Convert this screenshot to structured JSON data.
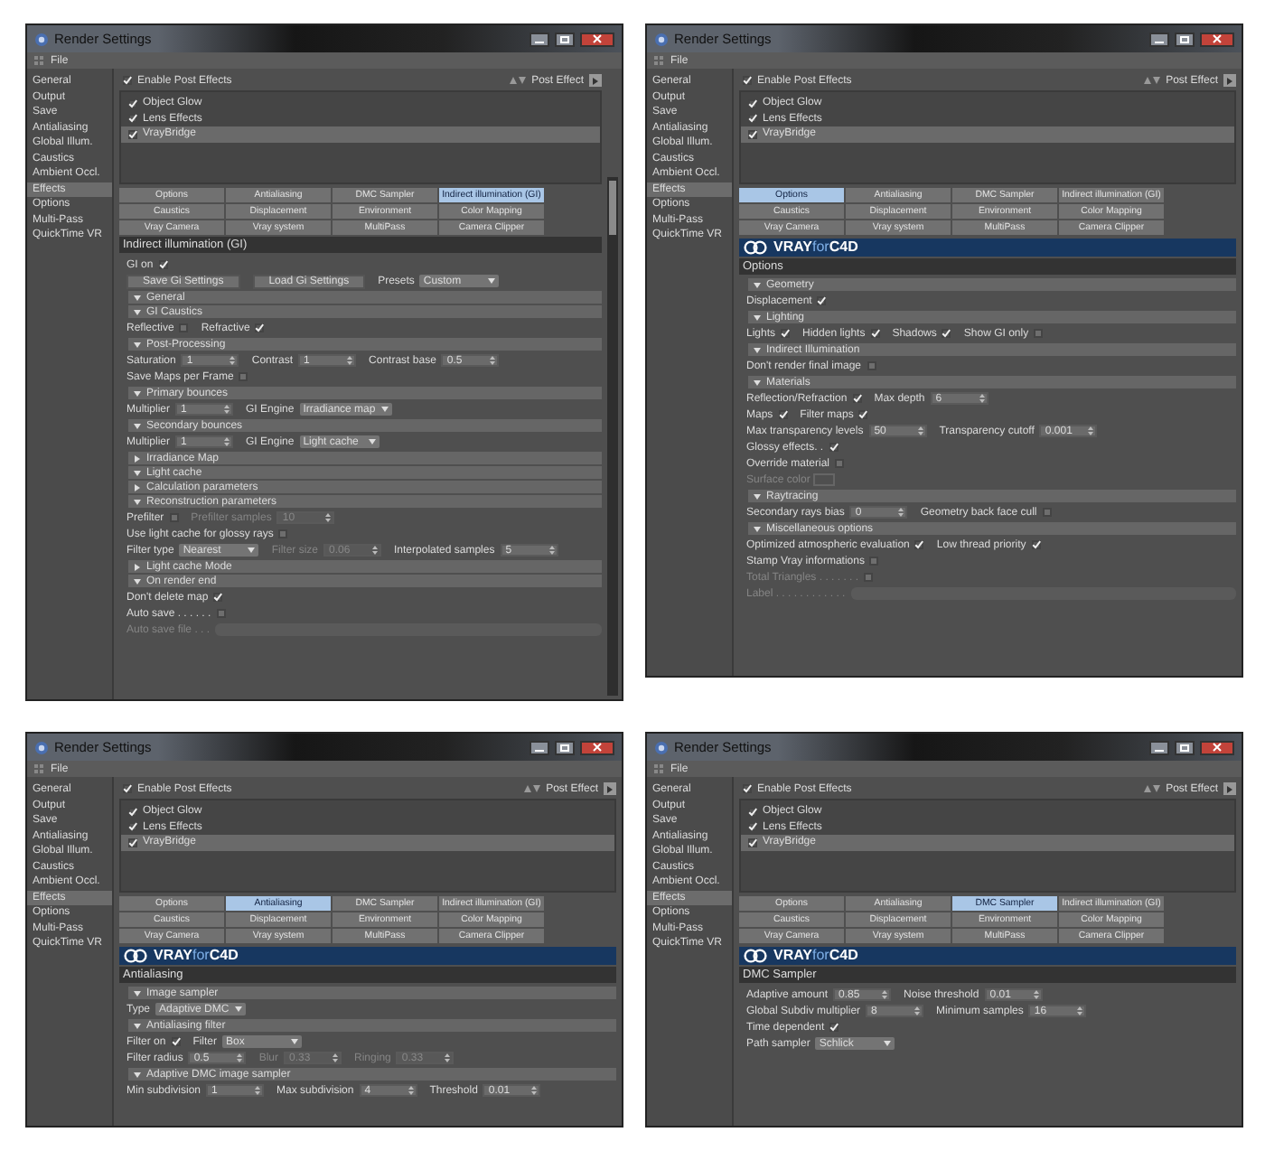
{
  "windows": [
    {
      "title": "Render Settings",
      "menu": [
        "File"
      ],
      "sidebar": [
        {
          "label": "General",
          "selected": false
        },
        {
          "label": "Output",
          "selected": false
        },
        {
          "label": "Save",
          "selected": false
        },
        {
          "label": "Antialiasing",
          "selected": false
        },
        {
          "label": "Global Illum.",
          "selected": false
        },
        {
          "label": "Caustics",
          "selected": false
        },
        {
          "label": "Ambient Occl.",
          "selected": false
        },
        {
          "label": "Effects",
          "selected": true
        },
        {
          "label": "Options",
          "selected": false
        },
        {
          "label": "Multi-Pass",
          "selected": false
        },
        {
          "label": "QuickTime VR",
          "selected": false
        }
      ],
      "enable_post_effects": {
        "label": "Enable Post Effects",
        "checked": true
      },
      "post_effect_label": "Post Effect",
      "effects": [
        {
          "label": "Object Glow",
          "checked": true,
          "selected": false
        },
        {
          "label": "Lens Effects",
          "checked": true,
          "selected": false
        },
        {
          "label": "VrayBridge",
          "checked": true,
          "selected": true
        }
      ],
      "tabs": [
        {
          "label": "Options",
          "selected": false
        },
        {
          "label": "Antialiasing",
          "selected": false
        },
        {
          "label": "DMC Sampler",
          "selected": false
        },
        {
          "label": "Indirect illumination (GI)",
          "selected": true
        },
        {
          "label": "Caustics",
          "selected": false
        },
        {
          "label": "Displacement",
          "selected": false
        },
        {
          "label": "Environment",
          "selected": false
        },
        {
          "label": "Color Mapping",
          "selected": false
        },
        {
          "label": "Vray Camera",
          "selected": false
        },
        {
          "label": "Vray system",
          "selected": false
        },
        {
          "label": "MultiPass",
          "selected": false
        },
        {
          "label": "Camera Clipper",
          "selected": false
        }
      ],
      "panel_title": "Indirect illumination (GI)",
      "scrollbar": true,
      "rows": [
        {
          "kind": "fields",
          "items": [
            {
              "kind": "checkbox",
              "label": "GI on",
              "checked": true,
              "disabled": false
            }
          ]
        },
        {
          "kind": "fields",
          "items": [
            {
              "kind": "button",
              "label": "Save Gi Settings"
            },
            {
              "kind": "button",
              "label": "Load Gi Settings"
            },
            {
              "kind": "dropdown",
              "label": "Presets",
              "value": "Custom",
              "disabled": false
            }
          ]
        },
        {
          "kind": "section",
          "label": "General",
          "expanded": true
        },
        {
          "kind": "section",
          "label": "GI Caustics",
          "expanded": true
        },
        {
          "kind": "fields",
          "items": [
            {
              "kind": "checkbox",
              "label": "Reflective",
              "checked": false,
              "disabled": false
            },
            {
              "kind": "checkbox",
              "label": "Refractive",
              "checked": true,
              "disabled": false
            }
          ]
        },
        {
          "kind": "section",
          "label": "Post-Processing",
          "expanded": true
        },
        {
          "kind": "fields",
          "items": [
            {
              "kind": "number",
              "label": "Saturation",
              "value": "1",
              "disabled": false
            },
            {
              "kind": "number",
              "label": "Contrast",
              "value": "1",
              "disabled": false
            },
            {
              "kind": "number",
              "label": "Contrast base",
              "value": "0.5",
              "disabled": false
            }
          ]
        },
        {
          "kind": "fields",
          "items": [
            {
              "kind": "checkbox",
              "label": "Save Maps per Frame",
              "checked": false,
              "disabled": false
            }
          ]
        },
        {
          "kind": "section",
          "label": "Primary bounces",
          "expanded": true
        },
        {
          "kind": "fields",
          "items": [
            {
              "kind": "number",
              "label": "Multiplier",
              "value": "1",
              "disabled": false
            },
            {
              "kind": "dropdown",
              "label": "GI Engine",
              "value": "Irradiance map",
              "disabled": false
            }
          ]
        },
        {
          "kind": "section",
          "label": "Secondary bounces",
          "expanded": true
        },
        {
          "kind": "fields",
          "items": [
            {
              "kind": "number",
              "label": "Multiplier",
              "value": "1",
              "disabled": false
            },
            {
              "kind": "dropdown",
              "label": "GI Engine",
              "value": "Light cache",
              "disabled": false
            }
          ]
        },
        {
          "kind": "section",
          "label": "Irradiance Map",
          "expanded": false
        },
        {
          "kind": "section",
          "label": "Light cache",
          "expanded": true
        },
        {
          "kind": "section",
          "label": "Calculation parameters",
          "expanded": false
        },
        {
          "kind": "section",
          "label": "Reconstruction parameters",
          "expanded": true
        },
        {
          "kind": "fields",
          "items": [
            {
              "kind": "checkbox",
              "label": "Prefilter",
              "checked": false,
              "disabled": false
            },
            {
              "kind": "number",
              "label": "Prefilter samples",
              "value": "10",
              "disabled": true
            }
          ]
        },
        {
          "kind": "fields",
          "items": [
            {
              "kind": "checkbox",
              "label": "Use light cache for glossy rays",
              "checked": false,
              "disabled": false
            }
          ]
        },
        {
          "kind": "fields",
          "items": [
            {
              "kind": "dropdown",
              "label": "Filter type",
              "value": "Nearest",
              "disabled": false
            },
            {
              "kind": "number",
              "label": "Filter size",
              "value": "0.06",
              "disabled": true
            },
            {
              "kind": "number",
              "label": "Interpolated samples",
              "value": "5",
              "disabled": false
            }
          ]
        },
        {
          "kind": "section",
          "label": "Light cache Mode",
          "expanded": false
        },
        {
          "kind": "section",
          "label": "On render end",
          "expanded": true
        },
        {
          "kind": "fields",
          "items": [
            {
              "kind": "checkbox",
              "label": "Don't delete map",
              "checked": true,
              "disabled": false
            }
          ]
        },
        {
          "kind": "fields",
          "items": [
            {
              "kind": "checkbox",
              "label": "Auto save . . . . . .",
              "checked": false,
              "disabled": false
            }
          ]
        },
        {
          "kind": "fields",
          "items": [
            {
              "kind": "text",
              "label": "Auto save file . . .",
              "disabled": true
            }
          ]
        }
      ]
    },
    {
      "title": "Render Settings",
      "menu": [
        "File"
      ],
      "sidebar": [
        {
          "label": "General",
          "selected": false
        },
        {
          "label": "Output",
          "selected": false
        },
        {
          "label": "Save",
          "selected": false
        },
        {
          "label": "Antialiasing",
          "selected": false
        },
        {
          "label": "Global Illum.",
          "selected": false
        },
        {
          "label": "Caustics",
          "selected": false
        },
        {
          "label": "Ambient Occl.",
          "selected": false
        },
        {
          "label": "Effects",
          "selected": true
        },
        {
          "label": "Options",
          "selected": false
        },
        {
          "label": "Multi-Pass",
          "selected": false
        },
        {
          "label": "QuickTime VR",
          "selected": false
        }
      ],
      "enable_post_effects": {
        "label": "Enable Post Effects",
        "checked": true
      },
      "post_effect_label": "Post Effect",
      "effects": [
        {
          "label": "Object Glow",
          "checked": true,
          "selected": false
        },
        {
          "label": "Lens Effects",
          "checked": true,
          "selected": false
        },
        {
          "label": "VrayBridge",
          "checked": true,
          "selected": true
        }
      ],
      "tabs": [
        {
          "label": "Options",
          "selected": true
        },
        {
          "label": "Antialiasing",
          "selected": false
        },
        {
          "label": "DMC Sampler",
          "selected": false
        },
        {
          "label": "Indirect illumination (GI)",
          "selected": false
        },
        {
          "label": "Caustics",
          "selected": false
        },
        {
          "label": "Displacement",
          "selected": false
        },
        {
          "label": "Environment",
          "selected": false
        },
        {
          "label": "Color Mapping",
          "selected": false
        },
        {
          "label": "Vray Camera",
          "selected": false
        },
        {
          "label": "Vray system",
          "selected": false
        },
        {
          "label": "MultiPass",
          "selected": false
        },
        {
          "label": "Camera Clipper",
          "selected": false
        }
      ],
      "logo": {
        "part_1": "VRAY",
        "part_2": "for",
        "part_3": "C4D"
      },
      "panel_title": "Options",
      "rows": [
        {
          "kind": "section",
          "label": "Geometry",
          "expanded": true
        },
        {
          "kind": "fields",
          "items": [
            {
              "kind": "checkbox",
              "label": "Displacement",
              "checked": true,
              "disabled": false
            }
          ]
        },
        {
          "kind": "section",
          "label": "Lighting",
          "expanded": true
        },
        {
          "kind": "fields",
          "items": [
            {
              "kind": "checkbox",
              "label": "Lights",
              "checked": true,
              "disabled": false
            },
            {
              "kind": "checkbox",
              "label": "Hidden lights",
              "checked": true,
              "disabled": false
            },
            {
              "kind": "checkbox",
              "label": "Shadows",
              "checked": true,
              "disabled": false
            },
            {
              "kind": "checkbox",
              "label": "Show GI only",
              "checked": false,
              "disabled": false
            }
          ]
        },
        {
          "kind": "section",
          "label": "Indirect Illumination",
          "expanded": true
        },
        {
          "kind": "fields",
          "items": [
            {
              "kind": "checkbox",
              "label": "Don't render final image",
              "checked": false,
              "disabled": false
            }
          ]
        },
        {
          "kind": "section",
          "label": "Materials",
          "expanded": true
        },
        {
          "kind": "fields",
          "items": [
            {
              "kind": "checkbox",
              "label": "Reflection/Refraction",
              "checked": true,
              "disabled": false
            },
            {
              "kind": "number",
              "label": "Max depth",
              "value": "6",
              "disabled": false
            }
          ]
        },
        {
          "kind": "fields",
          "items": [
            {
              "kind": "checkbox",
              "label": "Maps",
              "checked": true,
              "disabled": false
            },
            {
              "kind": "checkbox",
              "label": "Filter maps",
              "checked": true,
              "disabled": false
            }
          ]
        },
        {
          "kind": "fields",
          "items": [
            {
              "kind": "number",
              "label": "Max transparency levels",
              "value": "50",
              "disabled": false
            },
            {
              "kind": "number",
              "label": "Transparency cutoff",
              "value": "0.001",
              "disabled": false
            }
          ]
        },
        {
          "kind": "fields",
          "items": [
            {
              "kind": "checkbox",
              "label": "Glossy effects. .",
              "checked": true,
              "disabled": false
            }
          ]
        },
        {
          "kind": "fields",
          "items": [
            {
              "kind": "checkbox",
              "label": "Override material",
              "checked": false,
              "disabled": false
            }
          ]
        },
        {
          "kind": "fields",
          "items": [
            {
              "kind": "color",
              "label": "Surface color",
              "disabled": true
            }
          ]
        },
        {
          "kind": "section",
          "label": "Raytracing",
          "expanded": true
        },
        {
          "kind": "fields",
          "items": [
            {
              "kind": "number",
              "label": "Secondary rays bias",
              "value": "0",
              "disabled": false
            },
            {
              "kind": "checkbox",
              "label": "Geometry back face cull",
              "checked": false,
              "disabled": false
            }
          ]
        },
        {
          "kind": "section",
          "label": "Miscellaneous options",
          "expanded": true
        },
        {
          "kind": "fields",
          "items": [
            {
              "kind": "checkbox",
              "label": "Optimized atmospheric evaluation",
              "checked": true,
              "disabled": false
            },
            {
              "kind": "checkbox",
              "label": "Low thread priority",
              "checked": true,
              "disabled": false
            }
          ]
        },
        {
          "kind": "fields",
          "items": [
            {
              "kind": "checkbox",
              "label": "Stamp Vray informations",
              "checked": false,
              "disabled": false
            }
          ]
        },
        {
          "kind": "fields",
          "items": [
            {
              "kind": "checkbox",
              "label": "Total Triangles . . . . . . .",
              "checked": false,
              "disabled": true
            }
          ]
        },
        {
          "kind": "fields",
          "items": [
            {
              "kind": "text",
              "label": "Label . . . . . . . . . . . .",
              "disabled": true
            }
          ]
        }
      ]
    },
    {
      "title": "Render Settings",
      "menu": [
        "File"
      ],
      "sidebar": [
        {
          "label": "General",
          "selected": false
        },
        {
          "label": "Output",
          "selected": false
        },
        {
          "label": "Save",
          "selected": false
        },
        {
          "label": "Antialiasing",
          "selected": false
        },
        {
          "label": "Global Illum.",
          "selected": false
        },
        {
          "label": "Caustics",
          "selected": false
        },
        {
          "label": "Ambient Occl.",
          "selected": false
        },
        {
          "label": "Effects",
          "selected": true
        },
        {
          "label": "Options",
          "selected": false
        },
        {
          "label": "Multi-Pass",
          "selected": false
        },
        {
          "label": "QuickTime VR",
          "selected": false
        }
      ],
      "enable_post_effects": {
        "label": "Enable Post Effects",
        "checked": true
      },
      "post_effect_label": "Post Effect",
      "effects": [
        {
          "label": "Object Glow",
          "checked": true,
          "selected": false
        },
        {
          "label": "Lens Effects",
          "checked": true,
          "selected": false
        },
        {
          "label": "VrayBridge",
          "checked": true,
          "selected": true
        }
      ],
      "tabs": [
        {
          "label": "Options",
          "selected": false
        },
        {
          "label": "Antialiasing",
          "selected": true
        },
        {
          "label": "DMC Sampler",
          "selected": false
        },
        {
          "label": "Indirect illumination (GI)",
          "selected": false
        },
        {
          "label": "Caustics",
          "selected": false
        },
        {
          "label": "Displacement",
          "selected": false
        },
        {
          "label": "Environment",
          "selected": false
        },
        {
          "label": "Color Mapping",
          "selected": false
        },
        {
          "label": "Vray Camera",
          "selected": false
        },
        {
          "label": "Vray system",
          "selected": false
        },
        {
          "label": "MultiPass",
          "selected": false
        },
        {
          "label": "Camera Clipper",
          "selected": false
        }
      ],
      "logo": {
        "part_1": "VRAY",
        "part_2": "for",
        "part_3": "C4D"
      },
      "panel_title": "Antialiasing",
      "rows": [
        {
          "kind": "section",
          "label": "Image sampler",
          "expanded": true
        },
        {
          "kind": "fields",
          "items": [
            {
              "kind": "dropdown",
              "label": "Type",
              "value": "Adaptive DMC",
              "disabled": false
            }
          ]
        },
        {
          "kind": "section",
          "label": "Antialiasing filter",
          "expanded": true
        },
        {
          "kind": "fields",
          "items": [
            {
              "kind": "checkbox",
              "label": "Filter on",
              "checked": true,
              "disabled": false
            },
            {
              "kind": "dropdown",
              "label": "Filter",
              "value": "Box",
              "disabled": false
            }
          ]
        },
        {
          "kind": "fields",
          "items": [
            {
              "kind": "number",
              "label": "Filter radius",
              "value": "0.5",
              "disabled": false
            },
            {
              "kind": "number",
              "label": "Blur",
              "value": "0.33",
              "disabled": true
            },
            {
              "kind": "number",
              "label": "Ringing",
              "value": "0.33",
              "disabled": true
            }
          ]
        },
        {
          "kind": "section",
          "label": "Adaptive DMC image sampler",
          "expanded": true
        },
        {
          "kind": "fields",
          "items": [
            {
              "kind": "number",
              "label": "Min subdivision",
              "value": "1",
              "disabled": false
            },
            {
              "kind": "number",
              "label": "Max subdivision",
              "value": "4",
              "disabled": false
            },
            {
              "kind": "number",
              "label": "Threshold",
              "value": "0.01",
              "disabled": false
            }
          ]
        }
      ]
    },
    {
      "title": "Render Settings",
      "menu": [
        "File"
      ],
      "sidebar": [
        {
          "label": "General",
          "selected": false
        },
        {
          "label": "Output",
          "selected": false
        },
        {
          "label": "Save",
          "selected": false
        },
        {
          "label": "Antialiasing",
          "selected": false
        },
        {
          "label": "Global Illum.",
          "selected": false
        },
        {
          "label": "Caustics",
          "selected": false
        },
        {
          "label": "Ambient Occl.",
          "selected": false
        },
        {
          "label": "Effects",
          "selected": true
        },
        {
          "label": "Options",
          "selected": false
        },
        {
          "label": "Multi-Pass",
          "selected": false
        },
        {
          "label": "QuickTime VR",
          "selected": false
        }
      ],
      "enable_post_effects": {
        "label": "Enable Post Effects",
        "checked": true
      },
      "post_effect_label": "Post Effect",
      "effects": [
        {
          "label": "Object Glow",
          "checked": true,
          "selected": false
        },
        {
          "label": "Lens Effects",
          "checked": true,
          "selected": false
        },
        {
          "label": "VrayBridge",
          "checked": true,
          "selected": true
        }
      ],
      "tabs": [
        {
          "label": "Options",
          "selected": false
        },
        {
          "label": "Antialiasing",
          "selected": false
        },
        {
          "label": "DMC Sampler",
          "selected": true
        },
        {
          "label": "Indirect illumination (GI)",
          "selected": false
        },
        {
          "label": "Caustics",
          "selected": false
        },
        {
          "label": "Displacement",
          "selected": false
        },
        {
          "label": "Environment",
          "selected": false
        },
        {
          "label": "Color Mapping",
          "selected": false
        },
        {
          "label": "Vray Camera",
          "selected": false
        },
        {
          "label": "Vray system",
          "selected": false
        },
        {
          "label": "MultiPass",
          "selected": false
        },
        {
          "label": "Camera Clipper",
          "selected": false
        }
      ],
      "logo": {
        "part_1": "VRAY",
        "part_2": "for",
        "part_3": "C4D"
      },
      "panel_title": "DMC Sampler",
      "rows": [
        {
          "kind": "fields",
          "items": [
            {
              "kind": "number",
              "label": "Adaptive amount",
              "value": "0.85",
              "disabled": false
            },
            {
              "kind": "number",
              "label": "Noise threshold",
              "value": "0.01",
              "disabled": false
            }
          ]
        },
        {
          "kind": "fields",
          "items": [
            {
              "kind": "number",
              "label": "Global Subdiv multiplier",
              "value": "8",
              "disabled": false
            },
            {
              "kind": "number",
              "label": "Minimum samples",
              "value": "16",
              "disabled": false
            }
          ]
        },
        {
          "kind": "fields",
          "items": [
            {
              "kind": "checkbox",
              "label": "Time dependent",
              "checked": true,
              "disabled": false
            }
          ]
        },
        {
          "kind": "fields",
          "items": [
            {
              "kind": "dropdown",
              "label": "Path sampler",
              "value": "Schlick",
              "disabled": false
            }
          ]
        }
      ]
    }
  ]
}
